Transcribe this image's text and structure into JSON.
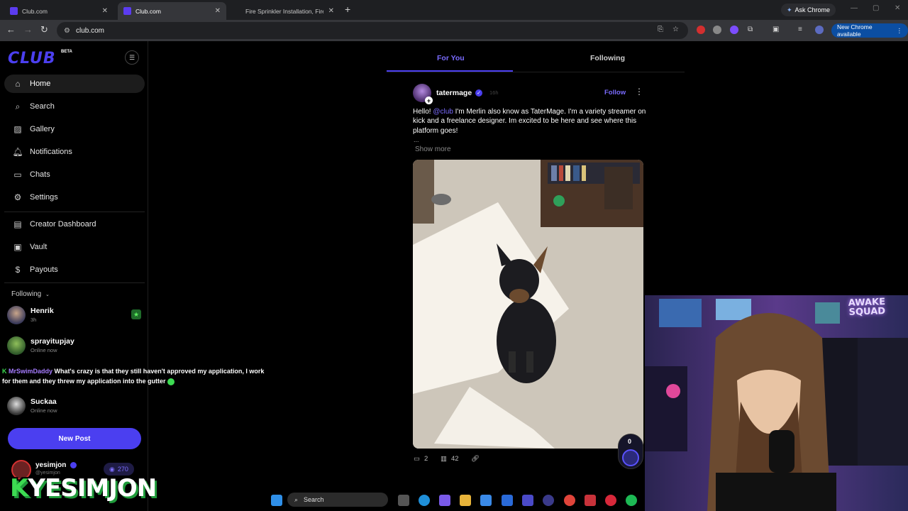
{
  "browser": {
    "tabs": [
      {
        "title": "Club.com"
      },
      {
        "title": "Club.com"
      },
      {
        "title": "Fire Sprinkler Installation, Fire A"
      }
    ],
    "ask_chrome": "Ask Chrome",
    "url": "club.com",
    "update_label": "New Chrome available"
  },
  "sidebar": {
    "logo": "CLUB",
    "beta": "BETA",
    "nav": [
      {
        "label": "Home",
        "icon": "home-icon"
      },
      {
        "label": "Search",
        "icon": "search-icon"
      },
      {
        "label": "Gallery",
        "icon": "gallery-icon"
      },
      {
        "label": "Notifications",
        "icon": "bell-icon"
      },
      {
        "label": "Chats",
        "icon": "chat-icon"
      },
      {
        "label": "Settings",
        "icon": "gear-icon"
      },
      {
        "label": "Creator Dashboard",
        "icon": "dashboard-icon"
      },
      {
        "label": "Vault",
        "icon": "vault-icon"
      },
      {
        "label": "Payouts",
        "icon": "dollar-icon"
      }
    ],
    "following_header": "Following",
    "following": [
      {
        "name": "Henrik",
        "sub": "3h"
      },
      {
        "name": "sprayitupjay",
        "sub": "Online now"
      },
      {
        "name": "Suckaa",
        "sub": "Online now"
      }
    ],
    "new_post": "New Post",
    "me": {
      "name": "yesimjon",
      "handle": "@yesimjon",
      "points": "270"
    }
  },
  "overlay": {
    "chat_user": "MrSwimDaddy",
    "chat_text": "What's crazy is that they still haven't approved my application, I work for them and they threw my application into the gutter",
    "brand": "YESIMJON",
    "brand_prefix": "K"
  },
  "feed": {
    "tabs": [
      "For You",
      "Following"
    ],
    "post": {
      "user": "tatermage",
      "time": "16h",
      "follow": "Follow",
      "text_pre": "Hello! ",
      "mention": "@club",
      "text_post": "  I'm Merlin also know as TaterMage. I'm a variety streamer on kick and a freelance designer. Im excited to be here and see where this platform goes!",
      "ellipsis": "...",
      "show_more": "Show more",
      "comments": "2",
      "views": "42",
      "boost_count": "0"
    }
  },
  "webcam": {
    "sign": "AWAKE\nSQUAD"
  },
  "taskbar": {
    "search": "Search"
  }
}
